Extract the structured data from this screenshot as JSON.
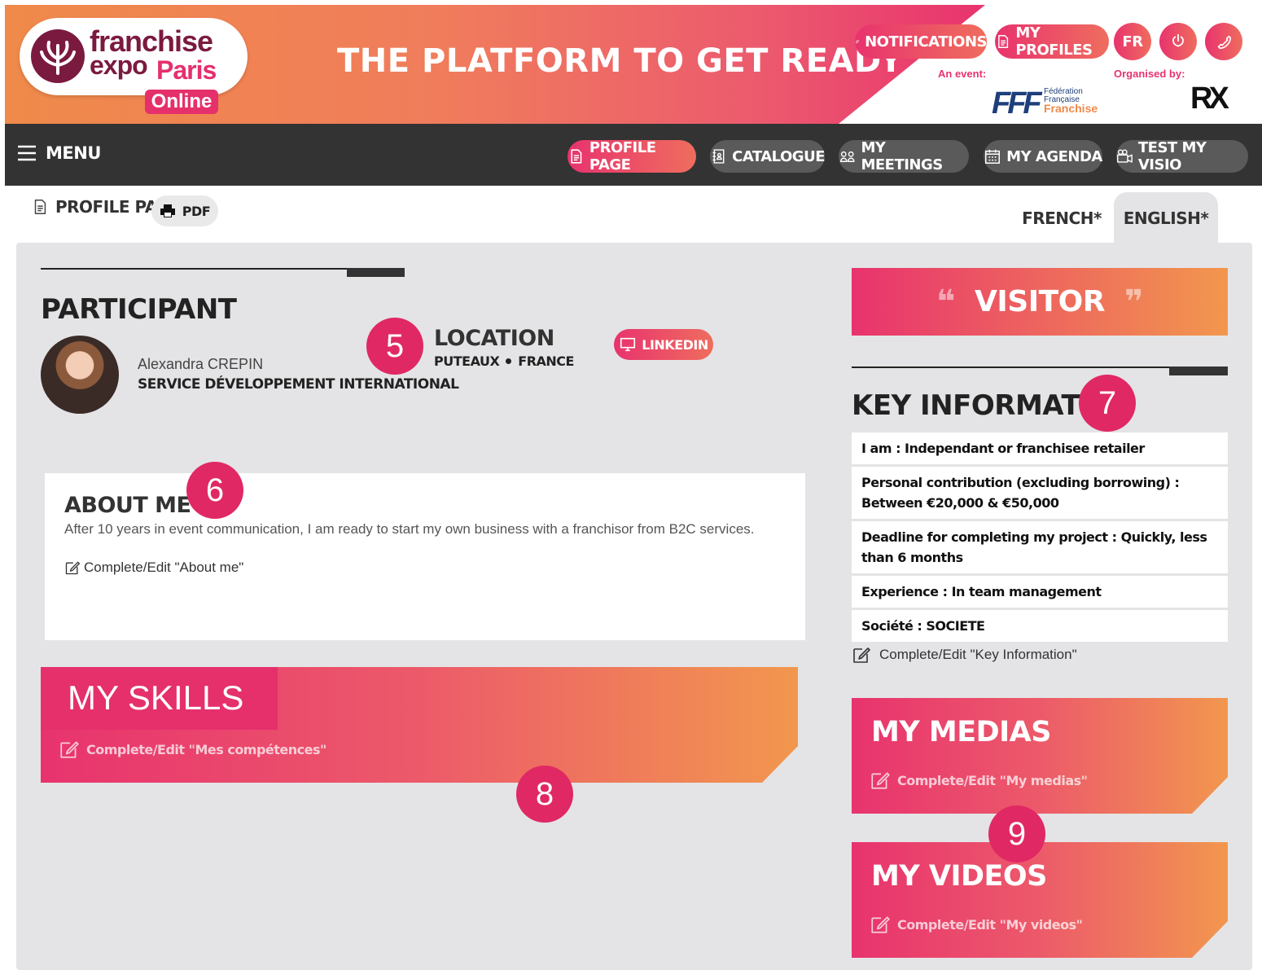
{
  "header": {
    "logo": {
      "line1": "franchise",
      "line2": "expo",
      "line3": "Paris",
      "badge": "Online"
    },
    "tagline": "THE PLATFORM TO GET READY",
    "buttons": {
      "notifications": "NOTIFICATIONS",
      "my_profiles": "MY PROFILES",
      "lang": "FR"
    },
    "event_label": "An event:",
    "organised_label": "Organised by:",
    "fff": {
      "mark": "FFF",
      "l1": "Fédération",
      "l2": "Française",
      "l3": "Franchise"
    },
    "rx": "RX"
  },
  "nav": {
    "menu": "MENU",
    "items": [
      {
        "label": "PROFILE PAGE",
        "active": true
      },
      {
        "label": "CATALOGUE"
      },
      {
        "label": "MY MEETINGS"
      },
      {
        "label": "MY AGENDA"
      },
      {
        "label": "TEST MY VISIO"
      }
    ]
  },
  "subbar": {
    "title": "PROFILE PAGE",
    "pdf": "PDF",
    "languages": [
      {
        "label": "FRENCH*"
      },
      {
        "label": "ENGLISH*",
        "active": true
      }
    ]
  },
  "participant": {
    "heading": "PARTICIPANT",
    "name": "Alexandra CREPIN",
    "department": "SERVICE DÉVELOPPEMENT INTERNATIONAL",
    "location_heading": "LOCATION",
    "city": "PUTEAUX",
    "country": "FRANCE",
    "linkedin": "LINKEDIN"
  },
  "about": {
    "heading": "ABOUT ME",
    "text": "After 10 years in event communication, I am ready to start my own business with a franchisor from B2C services.",
    "edit": "Complete/Edit \"About me\""
  },
  "skills": {
    "heading": "MY SKILLS",
    "edit": "Complete/Edit \"Mes compétences\""
  },
  "visitor": {
    "open_quote": "❝",
    "label": "VISITOR",
    "close_quote": "❞"
  },
  "key_info": {
    "heading": "KEY INFORMATION",
    "rows": [
      {
        "label": "I am",
        "value": "Independant or franchisee retailer"
      },
      {
        "label": "Personal contribution (excluding borrowing)",
        "value": "Between €20,000 & €50,000"
      },
      {
        "label": "Deadline for completing my project",
        "value": "Quickly, less than 6 months"
      },
      {
        "label": "Experience",
        "value": "In team management"
      },
      {
        "label": "Société",
        "value": "SOCIETE"
      }
    ],
    "edit": "Complete/Edit \"Key Information\""
  },
  "medias": {
    "heading": "MY MEDIAS",
    "edit": "Complete/Edit \"My medias\""
  },
  "videos": {
    "heading": "MY VIDEOS",
    "edit": "Complete/Edit \"My videos\""
  },
  "callouts": [
    "5",
    "6",
    "7",
    "8",
    "9"
  ],
  "colors": {
    "accent": "#e8336e",
    "accent_orange": "#f2974e",
    "nav_bg": "#333333",
    "panel_bg": "#e4e4e6",
    "badge": "#e02864"
  }
}
